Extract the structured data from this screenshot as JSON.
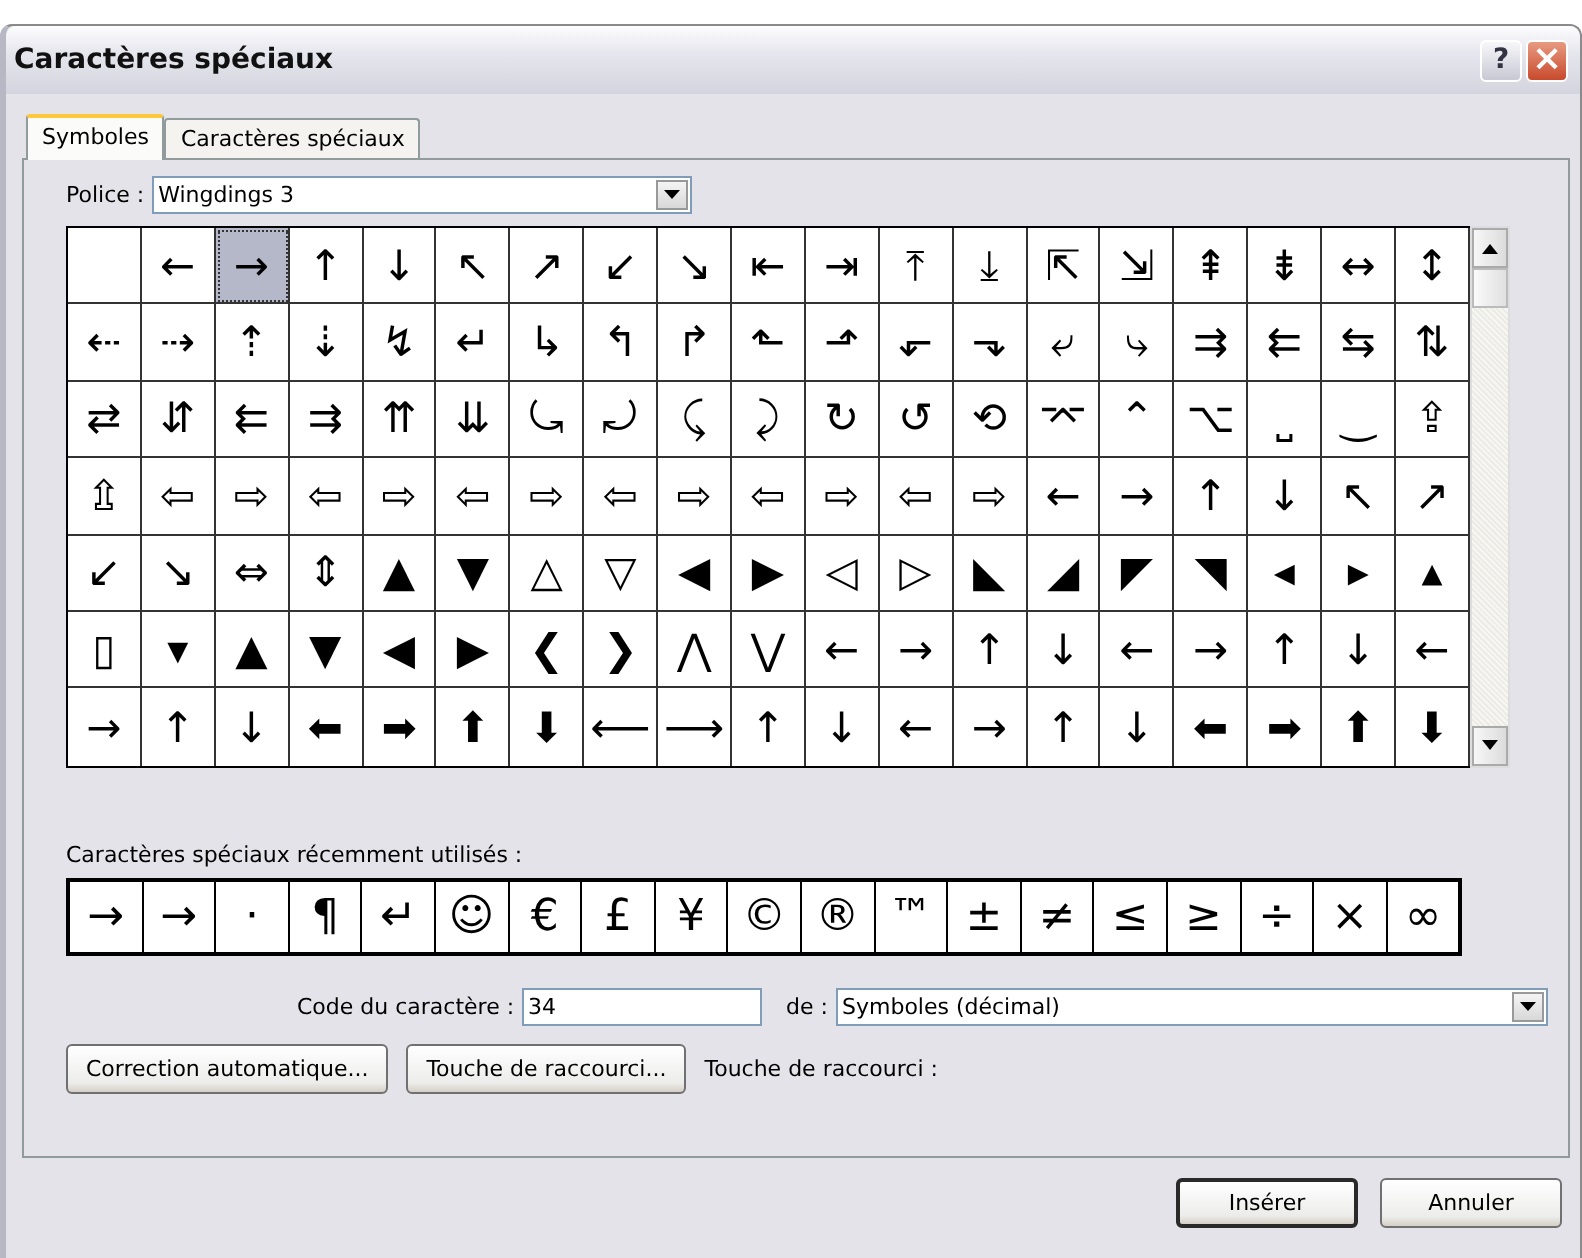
{
  "window": {
    "title": "Caractères spéciaux",
    "help_button": "?",
    "close_button": "×"
  },
  "tabs": [
    {
      "label": "Symboles",
      "selected": true
    },
    {
      "label": "Caractères spéciaux",
      "selected": false
    }
  ],
  "font": {
    "label": "Police :",
    "value": "Wingdings 3"
  },
  "grid": {
    "rows": [
      {
        "cells": [
          {
            "selected": false
          },
          {
            "char": "←",
            "selected": false
          },
          {
            "char": "→",
            "selected": true
          },
          {
            "char": "↑",
            "selected": false
          },
          {
            "char": "↓",
            "selected": false
          },
          {
            "char": "↖",
            "selected": false
          },
          {
            "char": "↗",
            "selected": false
          },
          {
            "char": "↙",
            "selected": false
          },
          {
            "char": "↘",
            "selected": false
          },
          {
            "char": "⇤",
            "selected": false
          },
          {
            "char": "⇥",
            "selected": false
          },
          {
            "char": "⤒",
            "selected": false
          },
          {
            "char": "⤓",
            "selected": false
          },
          {
            "char": "⇱",
            "selected": false
          },
          {
            "char": "⇲",
            "selected": false
          },
          {
            "char": "⇞",
            "selected": false
          },
          {
            "char": "⇟",
            "selected": false
          },
          {
            "char": "↔",
            "selected": false
          },
          {
            "char": "↕",
            "selected": false
          }
        ]
      },
      {
        "cells": [
          {
            "char": "⇠",
            "selected": false
          },
          {
            "char": "⇢",
            "selected": false
          },
          {
            "char": "⇡",
            "selected": false
          },
          {
            "char": "⇣",
            "selected": false
          },
          {
            "char": "↯",
            "selected": false
          },
          {
            "char": "↵",
            "selected": false
          },
          {
            "char": "↳",
            "selected": false
          },
          {
            "char": "↰",
            "selected": false
          },
          {
            "char": "↱",
            "selected": false
          },
          {
            "char": "⬑",
            "selected": false
          },
          {
            "char": "⬏",
            "selected": false
          },
          {
            "char": "⬐",
            "selected": false
          },
          {
            "char": "⬎",
            "selected": false
          },
          {
            "char": "⤶",
            "selected": false
          },
          {
            "char": "⤷",
            "selected": false
          },
          {
            "char": "⇉",
            "selected": false
          },
          {
            "char": "⇇",
            "selected": false
          },
          {
            "char": "⇆",
            "selected": false
          },
          {
            "char": "⇅",
            "selected": false
          }
        ]
      },
      {
        "cells": [
          {
            "char": "⇄",
            "selected": false
          },
          {
            "char": "⇵",
            "selected": false
          },
          {
            "char": "⇇",
            "selected": false
          },
          {
            "char": "⇉",
            "selected": false
          },
          {
            "char": "⇈",
            "selected": false
          },
          {
            "char": "⇊",
            "selected": false
          },
          {
            "char": "⤿",
            "selected": false
          },
          {
            "char": "⤾",
            "selected": false
          },
          {
            "char": "⤹",
            "selected": false
          },
          {
            "char": "⤸",
            "selected": false
          },
          {
            "char": "↻",
            "selected": false
          },
          {
            "char": "↺",
            "selected": false
          },
          {
            "char": "⟲",
            "selected": false
          },
          {
            "char": "⌤",
            "selected": false
          },
          {
            "char": "⌃",
            "selected": false
          },
          {
            "char": "⌥",
            "selected": false
          },
          {
            "char": "⎵",
            "selected": false
          },
          {
            "char": "‿",
            "selected": false
          },
          {
            "char": "⇪",
            "selected": false
          }
        ]
      },
      {
        "cells": [
          {
            "char": "⇫",
            "selected": false
          },
          {
            "char": "⇦",
            "selected": false
          },
          {
            "char": "⇨",
            "selected": false
          },
          {
            "char": "⇦",
            "selected": false
          },
          {
            "char": "⇨",
            "selected": false
          },
          {
            "char": "⇦",
            "selected": false
          },
          {
            "char": "⇨",
            "selected": false
          },
          {
            "char": "⇦",
            "selected": false
          },
          {
            "char": "⇨",
            "selected": false
          },
          {
            "char": "⇦",
            "selected": false
          },
          {
            "char": "⇨",
            "selected": false
          },
          {
            "char": "⇦",
            "selected": false
          },
          {
            "char": "⇨",
            "selected": false
          },
          {
            "char": "←",
            "selected": false
          },
          {
            "char": "→",
            "selected": false
          },
          {
            "char": "↑",
            "selected": false
          },
          {
            "char": "↓",
            "selected": false
          },
          {
            "char": "↖",
            "selected": false
          },
          {
            "char": "↗",
            "selected": false
          }
        ]
      },
      {
        "cells": [
          {
            "char": "↙",
            "selected": false
          },
          {
            "char": "↘",
            "selected": false
          },
          {
            "char": "⇔",
            "selected": false
          },
          {
            "char": "⇕",
            "selected": false
          },
          {
            "char": "▲",
            "selected": false
          },
          {
            "char": "▼",
            "selected": false
          },
          {
            "char": "△",
            "selected": false
          },
          {
            "char": "▽",
            "selected": false
          },
          {
            "char": "◀",
            "selected": false
          },
          {
            "char": "▶",
            "selected": false
          },
          {
            "char": "◁",
            "selected": false
          },
          {
            "char": "▷",
            "selected": false
          },
          {
            "char": "◣",
            "selected": false
          },
          {
            "char": "◢",
            "selected": false
          },
          {
            "char": "◤",
            "selected": false
          },
          {
            "char": "◥",
            "selected": false
          },
          {
            "char": "◂",
            "selected": false
          },
          {
            "char": "▸",
            "selected": false
          },
          {
            "char": "▴",
            "selected": false
          }
        ]
      },
      {
        "cells": [
          {
            "char": "▯",
            "selected": false
          },
          {
            "char": "▾",
            "selected": false
          },
          {
            "char": "▲",
            "selected": false
          },
          {
            "char": "▼",
            "selected": false
          },
          {
            "char": "◀",
            "selected": false
          },
          {
            "char": "▶",
            "selected": false
          },
          {
            "char": "❮",
            "selected": false
          },
          {
            "char": "❯",
            "selected": false
          },
          {
            "char": "⋀",
            "selected": false
          },
          {
            "char": "⋁",
            "selected": false
          },
          {
            "char": "←",
            "selected": false
          },
          {
            "char": "→",
            "selected": false
          },
          {
            "char": "↑",
            "selected": false
          },
          {
            "char": "↓",
            "selected": false
          },
          {
            "char": "←",
            "selected": false
          },
          {
            "char": "→",
            "selected": false
          },
          {
            "char": "↑",
            "selected": false
          },
          {
            "char": "↓",
            "selected": false
          },
          {
            "char": "←",
            "selected": false
          }
        ]
      },
      {
        "cells": [
          {
            "char": "→",
            "selected": false
          },
          {
            "char": "↑",
            "selected": false
          },
          {
            "char": "↓",
            "selected": false
          },
          {
            "char": "⬅",
            "selected": false
          },
          {
            "char": "➡",
            "selected": false
          },
          {
            "char": "⬆",
            "selected": false
          },
          {
            "char": "⬇",
            "selected": false
          },
          {
            "char": "⟵",
            "selected": false
          },
          {
            "char": "⟶",
            "selected": false
          },
          {
            "char": "↑",
            "selected": false
          },
          {
            "char": "↓",
            "selected": false
          },
          {
            "char": "←",
            "selected": false
          },
          {
            "char": "→",
            "selected": false
          },
          {
            "char": "↑",
            "selected": false
          },
          {
            "char": "↓",
            "selected": false
          },
          {
            "char": "⬅",
            "selected": false
          },
          {
            "char": "➡",
            "selected": false
          },
          {
            "char": "⬆",
            "selected": false
          },
          {
            "char": "⬇",
            "selected": false
          }
        ]
      }
    ]
  },
  "recent": {
    "label": "Caractères spéciaux récemment utilisés :",
    "chars": [
      "→",
      "→",
      "·",
      "¶",
      "↵",
      "☺",
      "€",
      "£",
      "¥",
      "©",
      "®",
      "™",
      "±",
      "≠",
      "≤",
      "≥",
      "÷",
      "×",
      "∞"
    ]
  },
  "code": {
    "label": "Code du caractère :",
    "value": "34",
    "from_label": "de :",
    "from_value": "Symboles (décimal)"
  },
  "buttons": [
    {
      "label": "Correction automatique..."
    },
    {
      "label": "Touche de raccourci..."
    }
  ],
  "shortcut_label": "Touche de raccourci :",
  "footer_buttons": [
    {
      "label": "Insérer",
      "default": true
    },
    {
      "label": "Annuler",
      "default": false
    }
  ]
}
